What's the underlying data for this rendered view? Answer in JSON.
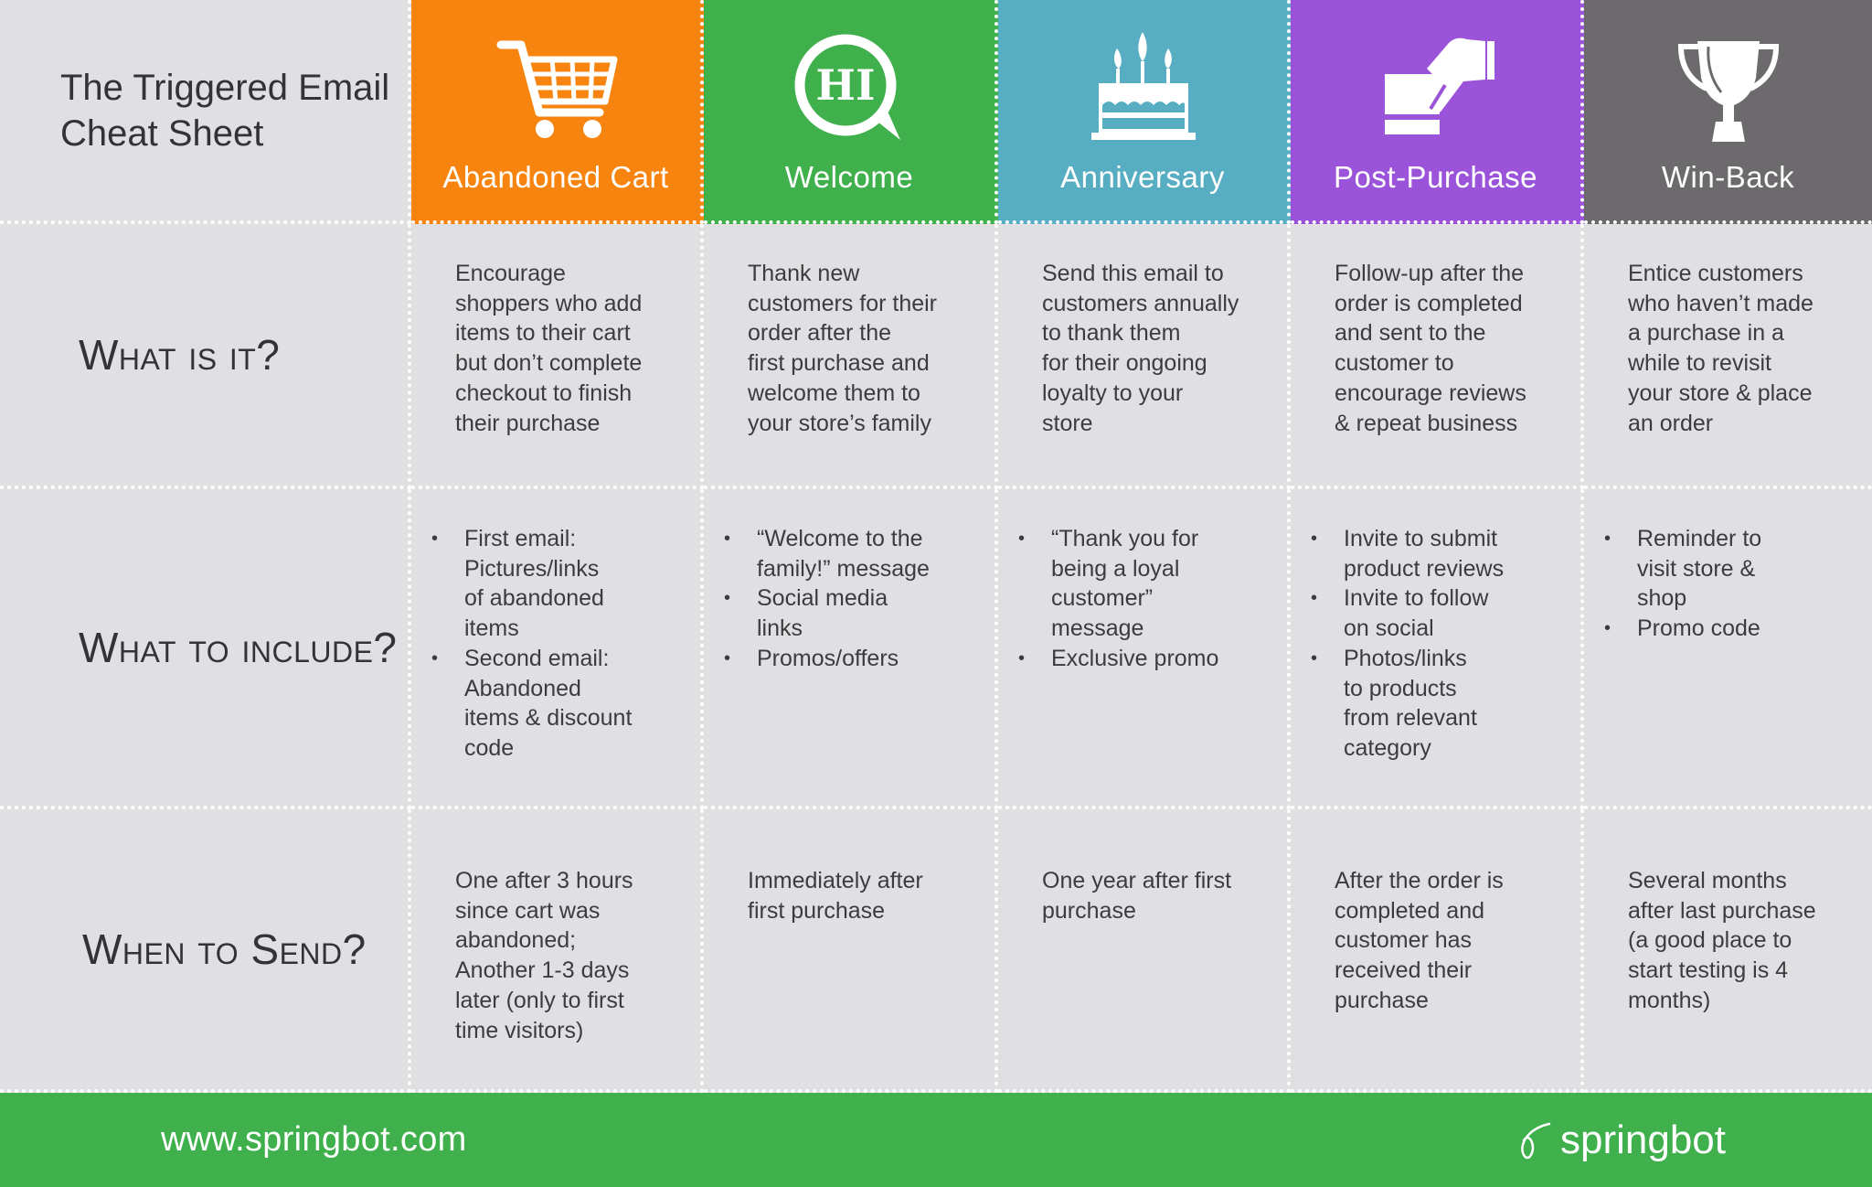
{
  "title": "The Triggered Email\nCheat Sheet",
  "colors": {
    "background": "#e0dfe2",
    "abandoned_cart": "#f7840f",
    "welcome": "#3fb04b",
    "anniversary": "#57adc2",
    "post_purchase": "#9b54d9",
    "win_back": "#6d6a6d",
    "footer": "#3fb04b"
  },
  "row_labels": {
    "what_is_it": "What is it?",
    "what_to_include": "What to include?",
    "when_to_send": "When to Send?"
  },
  "columns": [
    {
      "key": "abandoned_cart",
      "label": "Abandoned Cart",
      "icon": "shopping-cart-icon",
      "what_is_it": "Encourage\nshoppers who add\nitems to their cart\nbut don’t complete\ncheckout to finish\ntheir purchase",
      "what_to_include": [
        "First email:\nPictures/links\nof abandoned\nitems",
        "Second email:\nAbandoned\nitems & discount\ncode"
      ],
      "when_to_send": "One after 3 hours\nsince cart was\nabandoned;\nAnother 1-3 days\nlater (only to first\ntime visitors)"
    },
    {
      "key": "welcome",
      "label": "Welcome",
      "icon": "hi-speech-bubble-icon",
      "icon_text": "HI",
      "what_is_it": "Thank new\ncustomers for their\norder after the\nfirst purchase and\nwelcome them to\nyour store’s family",
      "what_to_include": [
        "“Welcome to the\nfamily!” message",
        "Social media\nlinks",
        "Promos/offers"
      ],
      "when_to_send": "Immediately after\nfirst purchase"
    },
    {
      "key": "anniversary",
      "label": "Anniversary",
      "icon": "birthday-cake-icon",
      "what_is_it": "Send this email to\ncustomers annually\nto thank them\nfor their ongoing\nloyalty to your\nstore",
      "what_to_include": [
        "“Thank you for\nbeing a loyal\ncustomer”\nmessage",
        "Exclusive promo"
      ],
      "when_to_send": "One year after first\npurchase"
    },
    {
      "key": "post_purchase",
      "label": "Post-Purchase",
      "icon": "hand-card-payment-icon",
      "what_is_it": "Follow-up after the\norder is completed\nand sent to the\ncustomer to\nencourage reviews\n& repeat business",
      "what_to_include": [
        "Invite to submit\nproduct reviews",
        "Invite to follow\non social",
        "Photos/links\nto products\nfrom relevant\ncategory"
      ],
      "when_to_send": "After the order is\ncompleted and\ncustomer has\nreceived their\npurchase"
    },
    {
      "key": "win_back",
      "label": "Win-Back",
      "icon": "trophy-icon",
      "what_is_it": "Entice customers\nwho haven’t made\na purchase in a\nwhile to revisit\nyour store & place\nan order",
      "what_to_include": [
        "Reminder to\nvisit store &\nshop",
        "Promo code"
      ],
      "when_to_send": "Several months\nafter last purchase\n(a good place to\nstart testing is 4\nmonths)"
    }
  ],
  "footer": {
    "url": "www.springbot.com",
    "logo_text": "springbot",
    "logo_icon": "springbot-swirl-icon"
  }
}
